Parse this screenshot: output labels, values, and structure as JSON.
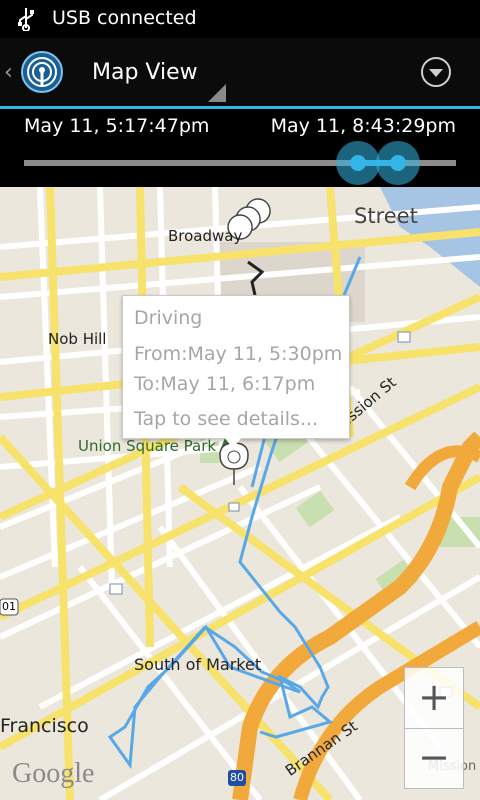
{
  "status_bar": {
    "text": "USB connected",
    "icon": "usb-icon"
  },
  "action_bar": {
    "title": "Map View",
    "app_icon": "broadcast-icon",
    "up_icon": "chevron-left-icon",
    "overflow_icon": "chevron-down-circle-icon"
  },
  "time_range": {
    "start": "May 11, 5:17:47pm",
    "end": "May 11, 8:43:29pm"
  },
  "map": {
    "labels": {
      "street": "Street",
      "broadway": "Broadway",
      "nob_hill": "Nob Hill",
      "union_square": "Union Square Park",
      "mission_st": "Mission St",
      "south_of_market": "South of Market",
      "francisco": "Francisco",
      "brannan_st": "Brannan St",
      "mission": "Mission",
      "hwy_80": "80",
      "hwy_101": "01",
      "google": "Google"
    },
    "route_color": "#58a8e8"
  },
  "popup": {
    "mode": "Driving",
    "from": "From:May 11, 5:30pm",
    "to": "To:May 11, 6:17pm",
    "details": "Tap to see details..."
  },
  "zoom": {
    "plus": "+",
    "minus": "−"
  }
}
